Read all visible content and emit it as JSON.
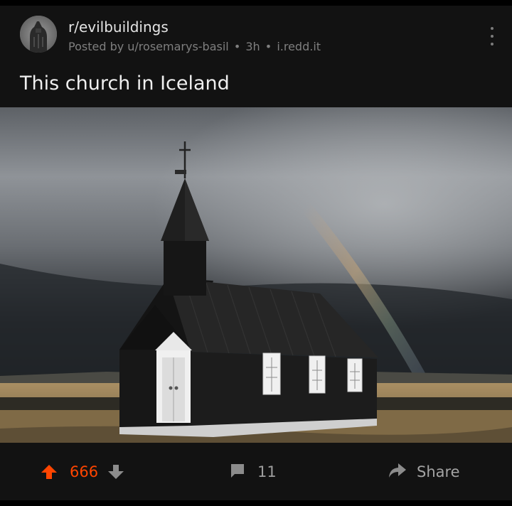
{
  "post": {
    "subreddit": "r/evilbuildings",
    "posted_by": "Posted by u/rosemarys-basil",
    "separator": "•",
    "age": "3h",
    "domain": "i.redd.it",
    "title": "This church in Iceland"
  },
  "actions": {
    "score": "666",
    "comments": "11",
    "share_label": "Share"
  },
  "icons": {
    "upvote": "arrow-up-icon",
    "downvote": "arrow-down-icon",
    "comment": "comment-bubble-icon",
    "share": "share-arrow-icon",
    "more": "more-vertical-icon"
  },
  "colors": {
    "background": "#121212",
    "upvote_active": "#ff4500",
    "muted_text": "#7f7f7f"
  }
}
